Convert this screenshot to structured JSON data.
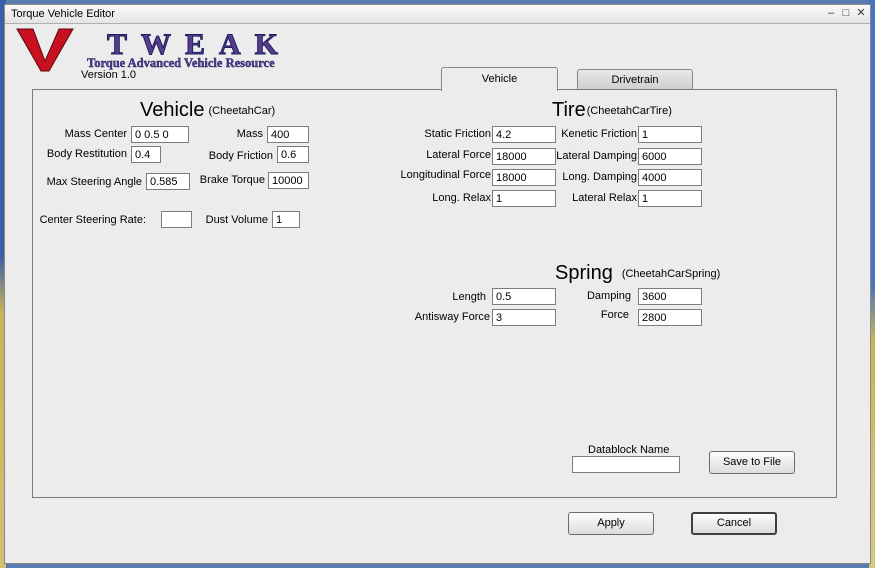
{
  "window": {
    "title": "Torque Vehicle Editor",
    "minimize_glyph": "–",
    "maximize_glyph": "□",
    "close_glyph": "✕"
  },
  "logo": {
    "letter": "V",
    "word": "TWEAK",
    "tagline": "Torque Advanced Vehicle Resource",
    "version": "Version 1.0"
  },
  "tabs": [
    {
      "label": "Vehicle",
      "active": true
    },
    {
      "label": "Drivetrain",
      "active": false
    }
  ],
  "vehicle": {
    "heading": "Vehicle",
    "datablock": "(CheetahCar)",
    "fields": {
      "mass_center": {
        "label": "Mass Center",
        "value": "0 0.5 0"
      },
      "mass": {
        "label": "Mass",
        "value": "400"
      },
      "body_restitution": {
        "label": "Body Restitution",
        "value": "0.4"
      },
      "body_friction": {
        "label": "Body Friction",
        "value": "0.6"
      },
      "max_steering_angle": {
        "label": "Max Steering Angle",
        "value": "0.585"
      },
      "brake_torque": {
        "label": "Brake Torque",
        "value": "10000"
      },
      "center_steering_rate": {
        "label": "Center Steering Rate:",
        "value": ""
      },
      "dust_volume": {
        "label": "Dust Volume",
        "value": "1"
      }
    }
  },
  "tire": {
    "heading": "Tire",
    "datablock": "(CheetahCarTire)",
    "fields": {
      "static_friction": {
        "label": "Static Friction",
        "value": "4.2"
      },
      "kenetic_friction": {
        "label": "Kenetic Friction",
        "value": "1"
      },
      "lateral_force": {
        "label": "Lateral Force",
        "value": "18000"
      },
      "lateral_damping": {
        "label": "Lateral Damping",
        "value": "6000"
      },
      "longitudinal_force": {
        "label": "Longitudinal Force",
        "value": "18000"
      },
      "long_damping": {
        "label": "Long. Damping",
        "value": "4000"
      },
      "long_relax": {
        "label": "Long. Relax",
        "value": "1"
      },
      "lateral_relax": {
        "label": "Lateral Relax",
        "value": "1"
      }
    }
  },
  "spring": {
    "heading": "Spring",
    "datablock": "(CheetahCarSpring)",
    "fields": {
      "length": {
        "label": "Length",
        "value": "0.5"
      },
      "damping": {
        "label": "Damping",
        "value": "3600"
      },
      "antisway_force": {
        "label": "Antisway Force",
        "value": "3"
      },
      "force": {
        "label": "Force",
        "value": "2800"
      }
    }
  },
  "datablock_name": {
    "label": "Datablock Name",
    "value": ""
  },
  "buttons": {
    "save_to_file": "Save to File",
    "apply": "Apply",
    "cancel": "Cancel"
  },
  "colors": {
    "logo_red": "#c81020",
    "logo_purple": "#5a3c8c",
    "logo_navy": "#1c2060"
  }
}
